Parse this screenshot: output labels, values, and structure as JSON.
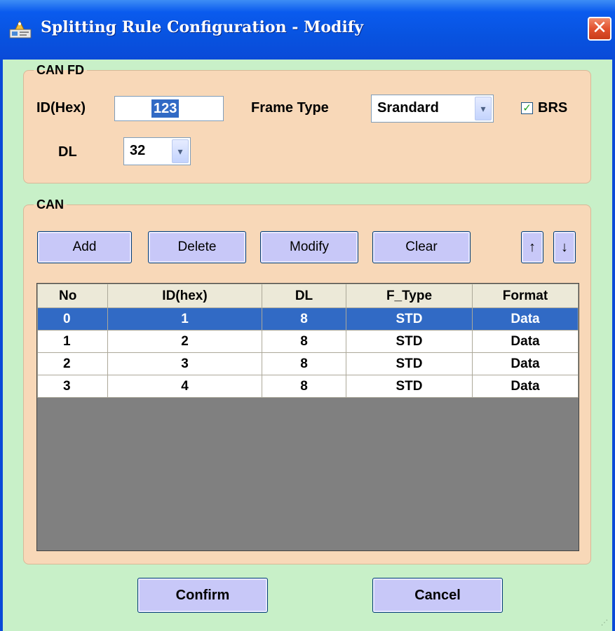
{
  "window": {
    "title": "Splitting Rule Configuration - Modify",
    "close_label": "✕"
  },
  "canfd": {
    "group_label": "CAN FD",
    "id_label": "ID(Hex)",
    "id_value": "123",
    "frame_type_label": "Frame Type",
    "frame_type_value": "Srandard",
    "brs_label": "BRS",
    "brs_checked": true,
    "dl_label": "DL",
    "dl_value": "32"
  },
  "can": {
    "group_label": "CAN",
    "buttons": {
      "add": "Add",
      "delete": "Delete",
      "modify": "Modify",
      "clear": "Clear",
      "up": "↑",
      "down": "↓"
    },
    "columns": [
      "No",
      "ID(hex)",
      "DL",
      "F_Type",
      "Format"
    ],
    "rows": [
      {
        "no": "0",
        "id": "1",
        "dl": "8",
        "ftype": "STD",
        "format": "Data",
        "selected": true
      },
      {
        "no": "1",
        "id": "2",
        "dl": "8",
        "ftype": "STD",
        "format": "Data",
        "selected": false
      },
      {
        "no": "2",
        "id": "3",
        "dl": "8",
        "ftype": "STD",
        "format": "Data",
        "selected": false
      },
      {
        "no": "3",
        "id": "4",
        "dl": "8",
        "ftype": "STD",
        "format": "Data",
        "selected": false
      }
    ]
  },
  "footer": {
    "confirm": "Confirm",
    "cancel": "Cancel"
  },
  "colors": {
    "titlebar": "#0a5bee",
    "client_bg": "#c8f0c8",
    "group_bg": "#f8d8b8",
    "button_bg": "#c8c8f8",
    "selection": "#316ac5",
    "grid_empty": "#808080"
  },
  "icons": {
    "title": "app-icon",
    "close": "close-icon",
    "checkbox": "check-icon",
    "combo": "chevron-down-icon"
  }
}
